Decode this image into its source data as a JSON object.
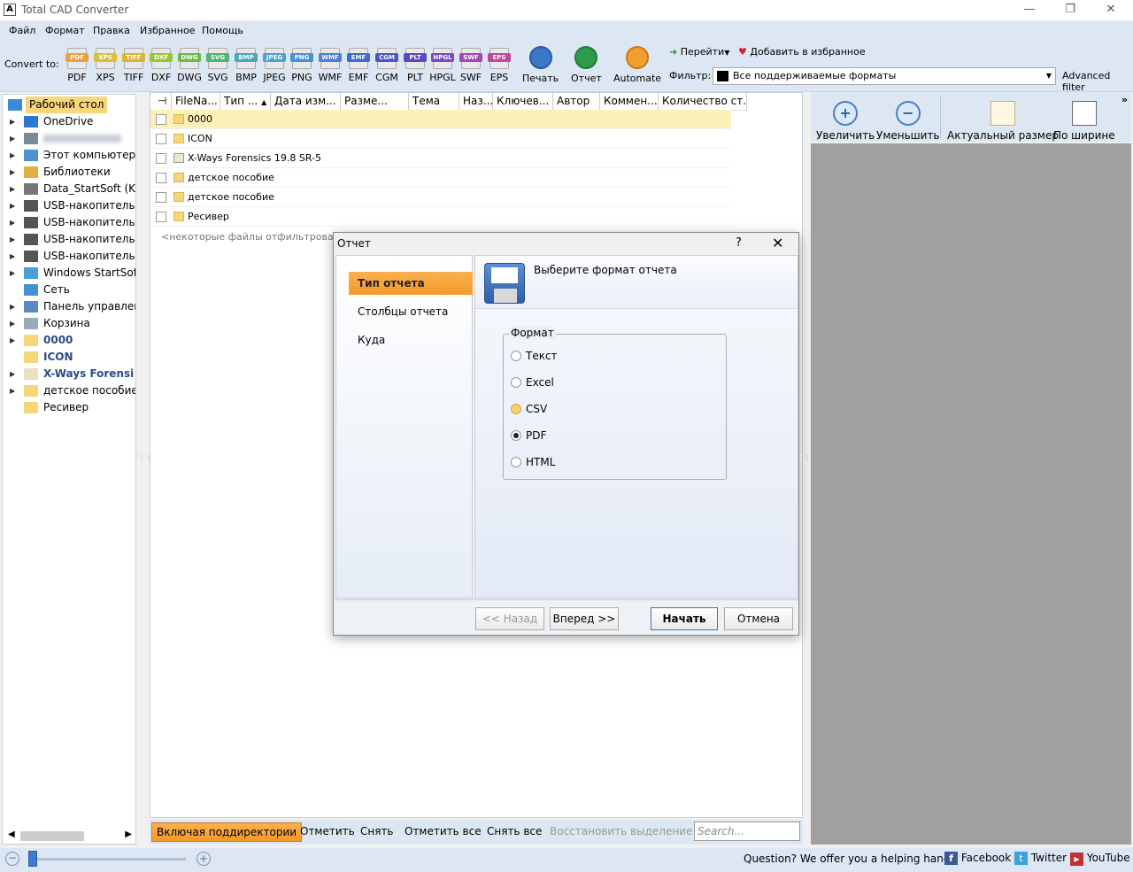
{
  "window": {
    "title": "Total CAD Converter",
    "minimize": "—",
    "restore": "❐",
    "close": "✕",
    "app_icon": "A"
  },
  "menu": [
    "Файл",
    "Формат",
    "Правка",
    "Избранное",
    "Помощь"
  ],
  "toolbar": {
    "convert_label": "Convert to:",
    "formats": [
      {
        "label": "PDF",
        "color": "#e8a042"
      },
      {
        "label": "XPS",
        "color": "#d7c03a"
      },
      {
        "label": "TIFF",
        "color": "#d9b53c"
      },
      {
        "label": "DXF",
        "color": "#9bc43a"
      },
      {
        "label": "DWG",
        "color": "#6cb84a"
      },
      {
        "label": "SVG",
        "color": "#4eb46e"
      },
      {
        "label": "BMP",
        "color": "#48a8b8"
      },
      {
        "label": "JPEG",
        "color": "#4aa0d0"
      },
      {
        "label": "PNG",
        "color": "#4a90d8"
      },
      {
        "label": "WMF",
        "color": "#4a7ed8"
      },
      {
        "label": "EMF",
        "color": "#3f6ad0"
      },
      {
        "label": "CGM",
        "color": "#4a54c8"
      },
      {
        "label": "PLT",
        "color": "#5a4ac0"
      },
      {
        "label": "HPGL",
        "color": "#7a48b8"
      },
      {
        "label": "SWF",
        "color": "#a048b0"
      },
      {
        "label": "EPS",
        "color": "#c0489a"
      }
    ],
    "print": "Печать",
    "report": "Отчет",
    "automate": "Automate",
    "goto": "Перейти",
    "add_fav": "Добавить в избранное",
    "filter_label": "Фильтр:",
    "filter_value": "Все поддерживаемые форматы",
    "advanced_filter": "Advanced filter"
  },
  "tree": [
    {
      "label": "Рабочий стол",
      "icon": "desktop-icon",
      "arrow": "",
      "selected": true,
      "bold": false
    },
    {
      "label": "OneDrive",
      "icon": "cloud-icon",
      "arrow": "▶",
      "bold": false
    },
    {
      "label": "",
      "icon": "user-icon",
      "arrow": "▶",
      "bold": false,
      "blurred": true
    },
    {
      "label": "Этот компьютер",
      "icon": "computer-icon",
      "arrow": "▶",
      "bold": false
    },
    {
      "label": "Библиотеки",
      "icon": "library-icon",
      "arrow": "▶",
      "bold": false
    },
    {
      "label": "Data_StartSoft (K",
      "icon": "drive-icon",
      "arrow": "▶",
      "bold": false
    },
    {
      "label": "USB-накопитель (",
      "icon": "usb-drive-icon",
      "arrow": "▶",
      "bold": false
    },
    {
      "label": "USB-накопитель (",
      "icon": "usb-drive-icon",
      "arrow": "▶",
      "bold": false
    },
    {
      "label": "USB-накопитель (",
      "icon": "usb-drive-icon",
      "arrow": "▶",
      "bold": false
    },
    {
      "label": "USB-накопитель (",
      "icon": "usb-drive-icon",
      "arrow": "▶",
      "bold": false
    },
    {
      "label": "Windows StartSof",
      "icon": "windows-drive-icon",
      "arrow": "▶",
      "bold": false
    },
    {
      "label": "Сеть",
      "icon": "network-icon",
      "arrow": "",
      "bold": false
    },
    {
      "label": "Панель управлен",
      "icon": "control-panel-icon",
      "arrow": "▶",
      "bold": false
    },
    {
      "label": "Корзина",
      "icon": "recycle-bin-icon",
      "arrow": "▶",
      "bold": false
    },
    {
      "label": "0000",
      "icon": "folder-icon",
      "arrow": "▶",
      "bold": true
    },
    {
      "label": "ICON",
      "icon": "folder-icon",
      "arrow": "",
      "bold": true
    },
    {
      "label": "X-Ways Forensi",
      "icon": "xways-icon",
      "arrow": "▶",
      "bold": true
    },
    {
      "label": "детское пособие",
      "icon": "folder-icon",
      "arrow": "▶",
      "bold": false
    },
    {
      "label": "Ресивер",
      "icon": "folder-icon",
      "arrow": "",
      "bold": false
    }
  ],
  "columns": [
    "FileNa...",
    "Тип ...",
    "Дата изм...",
    "Разме...",
    "Тема",
    "Наз...",
    "Ключев...",
    "Автор",
    "Коммен...",
    "Количество ст..."
  ],
  "files": [
    {
      "name": "0000",
      "type": "folder"
    },
    {
      "name": "ICON",
      "type": "folder"
    },
    {
      "name": "X-Ways Forensics 19.8 SR-5",
      "type": "xways"
    },
    {
      "name": "детское пособие",
      "type": "folder"
    },
    {
      "name": "детское пособие",
      "type": "folder"
    },
    {
      "name": "Ресивер",
      "type": "folder"
    }
  ],
  "filtered_note": "<некоторые файлы отфильтрованы, д",
  "actions": {
    "include_subdirs": "Включая поддиректории",
    "check": "Отметить",
    "uncheck": "Снять",
    "check_all": "Отметить все",
    "uncheck_all": "Снять все",
    "restore_sel": "Восстановить выделение",
    "search_placeholder": "Search..."
  },
  "viewer": {
    "zoom_in": "Увеличить",
    "zoom_out": "Уменьшить",
    "actual": "Актуальный размер",
    "fit_width": "По ширине"
  },
  "status": {
    "question": "Question? We offer you a helping hand -",
    "facebook": "Facebook",
    "twitter": "Twitter",
    "youtube": "YouTube",
    "zoom_minus": "−",
    "zoom_plus": "+"
  },
  "dialog": {
    "title": "Отчет",
    "help": "?",
    "close": "✕",
    "nav": [
      "Тип отчета",
      "Столбцы отчета",
      "Куда"
    ],
    "header": "Выберите формат отчета",
    "group": "Формат",
    "options": [
      "Текст",
      "Excel",
      "CSV",
      "PDF",
      "HTML"
    ],
    "selected": "PDF",
    "back": "<< Назад",
    "next": "Вперед >>",
    "start": "Начать",
    "cancel": "Отмена"
  }
}
